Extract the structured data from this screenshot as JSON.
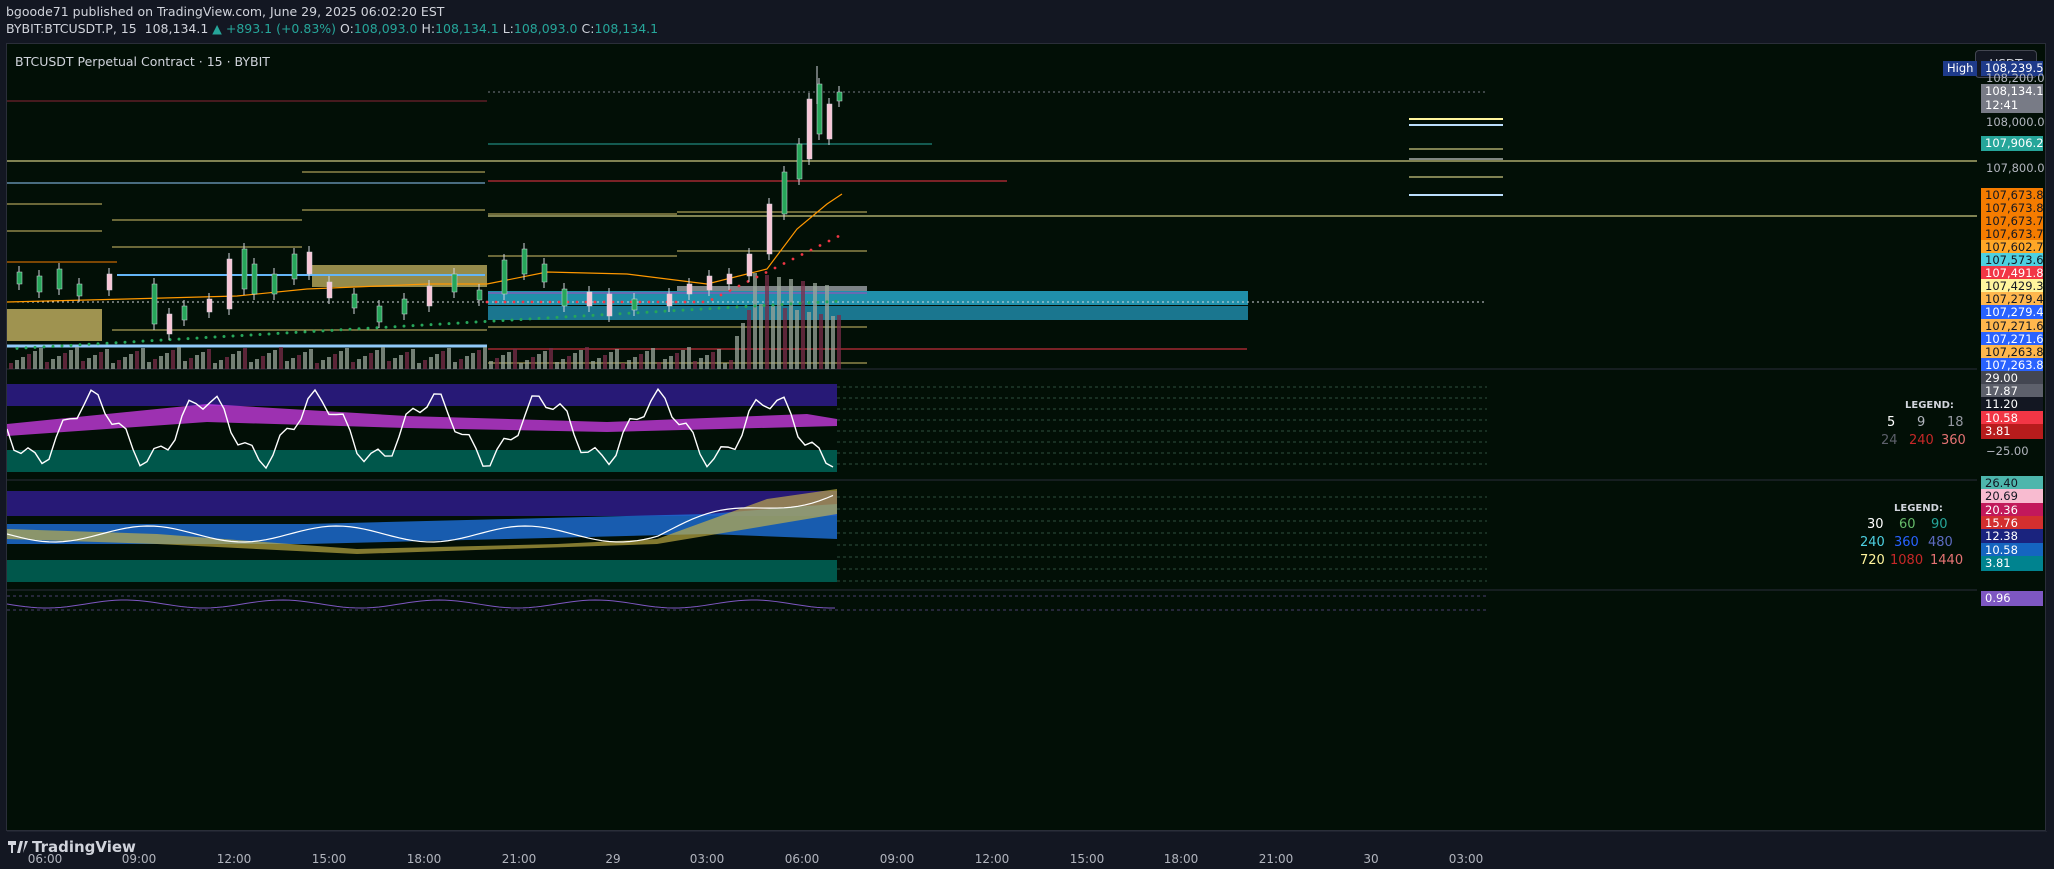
{
  "header": {
    "line1": "bgoode71 published on TradingView.com, June 29, 2025 06:02:20 EST",
    "symbol": "BYBIT:BTCUSDT.P, 15",
    "last": "108,134.1",
    "change": "▲ +893.1 (+0.83%)",
    "o_label": "O:",
    "o": "108,093.0",
    "h_label": "H:",
    "h": "108,134.1",
    "l_label": "L:",
    "l": "108,093.0",
    "c_label": "C:",
    "c": "108,134.1"
  },
  "chart": {
    "title": "BTCUSDT Perpetual Contract · 15 · BYBIT",
    "currency_button": "USDT",
    "high_label": "High",
    "high_value": "108,239.5",
    "price_axis": [
      "108,200.0",
      "108,000.0",
      "107,800.0"
    ],
    "current_price": "108,134.1",
    "countdown": "12:41",
    "price_tags": [
      {
        "v": "107,906.2",
        "bg": "#26a69a",
        "fg": "#ffffff"
      },
      {
        "v": "107,673.8",
        "bg": "#f57c00",
        "fg": "#131722"
      },
      {
        "v": "107,673.8",
        "bg": "#f57c00",
        "fg": "#131722"
      },
      {
        "v": "107,673.7",
        "bg": "#f57c00",
        "fg": "#131722"
      },
      {
        "v": "107,673.7",
        "bg": "#f57c00",
        "fg": "#131722"
      },
      {
        "v": "107,602.7",
        "bg": "#ffa726",
        "fg": "#131722"
      },
      {
        "v": "107,573.6",
        "bg": "#4dd0e1",
        "fg": "#131722"
      },
      {
        "v": "107,491.8",
        "bg": "#f23645",
        "fg": "#ffffff"
      },
      {
        "v": "107,429.3",
        "bg": "#fff59d",
        "fg": "#131722"
      },
      {
        "v": "107,279.4",
        "bg": "#ffb74d",
        "fg": "#131722"
      },
      {
        "v": "107,279.4",
        "bg": "#2962ff",
        "fg": "#ffffff"
      },
      {
        "v": "107,271.6",
        "bg": "#ffb74d",
        "fg": "#131722"
      },
      {
        "v": "107,271.6",
        "bg": "#2962ff",
        "fg": "#ffffff"
      },
      {
        "v": "107,263.8",
        "bg": "#ffb74d",
        "fg": "#131722"
      },
      {
        "v": "107,263.8",
        "bg": "#2962ff",
        "fg": "#ffffff"
      }
    ],
    "pane1": {
      "tags": [
        {
          "v": "29.00",
          "bg": "#434651",
          "fg": "#ffffff"
        },
        {
          "v": "17.87",
          "bg": "#5d606b",
          "fg": "#ffffff"
        },
        {
          "v": "11.20",
          "bg": "#131722",
          "fg": "#ffffff"
        },
        {
          "v": "10.58",
          "bg": "#f23645",
          "fg": "#ffffff"
        },
        {
          "v": "3.81",
          "bg": "#b71c1c",
          "fg": "#ffffff"
        }
      ],
      "axis_label": "−25.00",
      "legend_title": "LEGEND:",
      "legend_row1": [
        "5",
        "9",
        "18"
      ],
      "legend_row2": [
        "24",
        "240",
        "360"
      ]
    },
    "pane2": {
      "tags": [
        {
          "v": "26.40",
          "bg": "#4db6ac",
          "fg": "#131722"
        },
        {
          "v": "20.69",
          "bg": "#f8bbd0",
          "fg": "#131722"
        },
        {
          "v": "20.36",
          "bg": "#c2185b",
          "fg": "#ffffff"
        },
        {
          "v": "15.76",
          "bg": "#d32f2f",
          "fg": "#ffffff"
        },
        {
          "v": "12.38",
          "bg": "#1a237e",
          "fg": "#ffffff"
        },
        {
          "v": "10.58",
          "bg": "#1565c0",
          "fg": "#ffffff"
        },
        {
          "v": "3.81",
          "bg": "#00838f",
          "fg": "#ffffff"
        }
      ],
      "legend_title": "LEGEND:",
      "legend_row1": [
        "30",
        "60",
        "90"
      ],
      "legend_row2": [
        "240",
        "360",
        "480"
      ],
      "legend_row3": [
        "720",
        "1080",
        "1440"
      ]
    },
    "pane3": {
      "tag": "0.96"
    },
    "time_axis": [
      "06:00",
      "09:00",
      "12:00",
      "15:00",
      "18:00",
      "21:00",
      "29",
      "03:00",
      "06:00",
      "09:00",
      "12:00",
      "15:00",
      "18:00",
      "21:00",
      "30",
      "03:00"
    ]
  },
  "footer": {
    "brand": "TradingView"
  }
}
